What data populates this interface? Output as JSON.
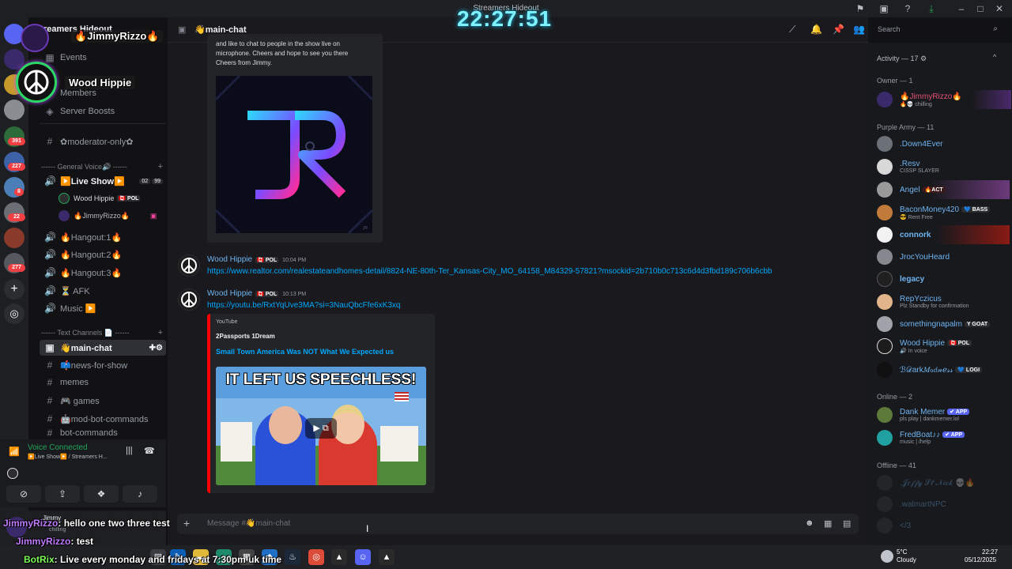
{
  "window": {
    "title": "Streamers Hideout"
  },
  "server": {
    "name": "Streamers Hideout"
  },
  "overlay": {
    "clock": "22:27:51",
    "streamer_name": "JimmyRizzo",
    "streamer_flame": "🔥",
    "featured_name": "Wood Hippie",
    "chat": [
      {
        "user": "JimmyRizzo",
        "text": ": hello one two three test"
      },
      {
        "user": "JimmyRizzo",
        "text": ": test"
      },
      {
        "user": "BotRix",
        "text": ": Live every monday and fridays at 7:30pm uk time"
      }
    ]
  },
  "rail": {
    "badges": [
      "391",
      "227",
      "8",
      "22",
      "277"
    ]
  },
  "sidebar": {
    "items": [
      {
        "label": "Events",
        "icon": "calendar-icon"
      },
      {
        "label": "Members",
        "icon": "members-icon"
      },
      {
        "label": "Server Boosts",
        "icon": "boost-icon"
      }
    ],
    "moderator_channel": "✿moderator-only✿",
    "voice_category": "------ General Voice🔊 ------",
    "live_show": {
      "label": "▶️Live Show▶️",
      "count_a": "02",
      "count_b": "99"
    },
    "voice_users": [
      {
        "name": "Wood Hippie",
        "tag": "🇨🇦 POL"
      },
      {
        "name": "🔥JimmyRizzo🔥",
        "tag": ""
      }
    ],
    "voice_channels": [
      "🔥Hangout:1🔥",
      "🔥Hangout:2🔥",
      "🔥Hangout:3🔥",
      "⏳ AFK",
      "Music ▶️"
    ],
    "text_category": "------ Text Channels 📄 ------",
    "text_channels": [
      "👋main-chat",
      "📫news-for-show",
      "memes",
      "🎮 games",
      "🤖mod-bot-commands",
      "bot-commands"
    ]
  },
  "voice_panel": {
    "status": "Voice Connected",
    "location": "▶️Live Show▶️ / Streamers H...",
    "user_name": "Jimmy",
    "user_status": "chilling"
  },
  "header": {
    "channel": "👋main-chat",
    "search_placeholder": "Search"
  },
  "messages": {
    "partial_text": [
      "and like to chat to people in the show live on",
      "microphone. Cheers and hope to see you there",
      "Cheers from Jimmy."
    ],
    "image_credit": "JR",
    "posts": [
      {
        "user": "Wood Hippie",
        "tag": "🇨🇦 POL",
        "time": "10:04 PM",
        "link": "https://www.realtor.com/realestateandhomes-detail/8824-NE-80th-Ter_Kansas-City_MO_64158_M84329-57821?msockid=2b710b0c713c6d4d3fbd189c706b6cbb"
      },
      {
        "user": "Wood Hippie",
        "tag": "🇨🇦 POL",
        "time": "10:13 PM",
        "link": "https://youtu.be/RxtYqUve3MA?si=3NauQbcFfe6xK3xq"
      }
    ],
    "embed": {
      "provider": "YouTube",
      "author": "2Passports 1Dream",
      "title": "Small Town America Was NOT What We Expected us",
      "thumb_text": "IT LEFT US SPEECHLESS!"
    }
  },
  "composer": {
    "placeholder": "Message #👋main-chat"
  },
  "members": {
    "activity_header": "Activity — 17 ⚙",
    "owner_header": "Owner — 1",
    "owner": {
      "name": "🔥JimmyRizzo🔥",
      "sub": "🔥💀 chilling"
    },
    "purple_header": "Purple Army — 11",
    "purple": [
      {
        "name": ".Down4Ever",
        "sub": "",
        "tag": "",
        "color": "#6fb4f0"
      },
      {
        "name": ".Resv",
        "sub": "CISSP SLAYER",
        "tag": "",
        "color": "#6fb4f0"
      },
      {
        "name": "Angel",
        "sub": "",
        "tag": "🔥ACT",
        "color": "#6fb4f0"
      },
      {
        "name": "BaconMoney420",
        "sub": "😎 Rent Free",
        "tag": "💙 BASS",
        "color": "#6fb4f0"
      },
      {
        "name": "connork",
        "sub": "",
        "tag": "",
        "color": "#6fb4f0"
      },
      {
        "name": "JrocYouHeard",
        "sub": "",
        "tag": "",
        "color": "#6fb4f0"
      },
      {
        "name": "legacy",
        "sub": "",
        "tag": "",
        "color": "#6fb4f0"
      },
      {
        "name": "RepYczicus",
        "sub": "Plz Standby for confirmation",
        "tag": "",
        "color": "#6fb4f0"
      },
      {
        "name": "somethingnapalm",
        "sub": "",
        "tag": "Y GOAT",
        "color": "#6fb4f0"
      },
      {
        "name": "Wood Hippie",
        "sub": "🔊 In voice",
        "tag": "🇨🇦 POL",
        "color": "#6fb4f0"
      },
      {
        "name": "ℬ𝒟ark𝑀ℴ𝑑𝓃ℯ𝓈𝓈",
        "sub": "",
        "tag": "💙 LOGI",
        "color": "#6fb4f0"
      }
    ],
    "online_header": "Online — 2",
    "online": [
      {
        "name": "Dank Memer",
        "sub": "pls play | dankmemer.lol",
        "tag": "✔ APP"
      },
      {
        "name": "FredBoat♪♪",
        "sub": "music | /help",
        "tag": "✔ APP"
      }
    ],
    "offline_header": "Offline — 41",
    "offline": [
      ".𝒥𝑒𝒻𝒻𝓎 𝒮𝓉 𝒩𝒾𝒸𝓀 💀🔥",
      ".walmartNPC",
      "</3"
    ]
  },
  "taskbar": {
    "weather_temp": "5°C",
    "weather_desc": "Cloudy",
    "time": "22:27",
    "date": "05/12/2025"
  },
  "colors": {
    "accent": "#5865f2",
    "link": "#00a8fc",
    "role_blue": "#6fb4f0",
    "voice_green": "#23a55a",
    "danger": "#f23f43"
  }
}
